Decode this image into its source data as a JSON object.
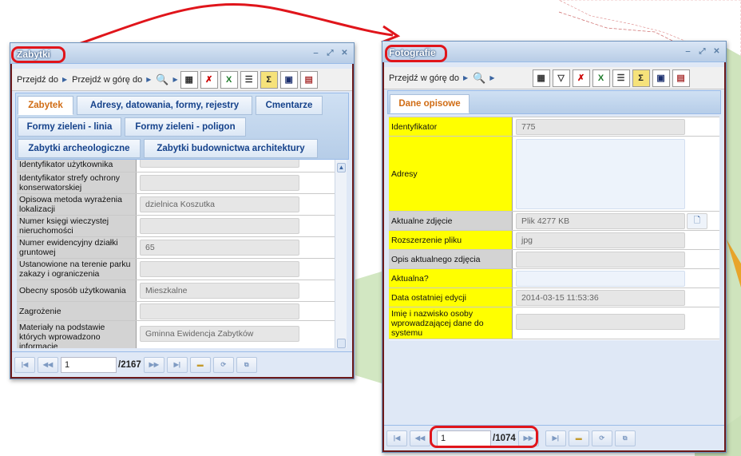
{
  "colors": {
    "highlight": "#e0151b",
    "window_border": "#6d1a1a",
    "required_label": "#ffff00",
    "tab_active_text": "#d06c14"
  },
  "window1": {
    "title": "Zabytki",
    "toolbar": {
      "goto": "Przejdź do",
      "goto_up": "Przejdź w górę do"
    },
    "tabs": [
      "Zabytek",
      "Adresy, datowania, formy, rejestry",
      "Cmentarze",
      "Formy zieleni - linia",
      "Formy zieleni - poligon",
      "Zabytki archeologiczne",
      "Zabytki budownictwa architektury"
    ],
    "rows": [
      {
        "label": "Identyfikator użytkownika",
        "value": ""
      },
      {
        "label": "Identyfikator strefy ochrony konserwatorskiej",
        "value": ""
      },
      {
        "label": "Opisowa metoda wyrażenia lokalizacji",
        "value": "dzielnica Koszutka"
      },
      {
        "label": "Numer księgi wieczystej nieruchomości",
        "value": ""
      },
      {
        "label": "Numer ewidencyjny działki gruntowej",
        "value": "65"
      },
      {
        "label": "Ustanowione na terenie parku zakazy i ograniczenia",
        "value": ""
      },
      {
        "label": "Obecny sposób użytkowania",
        "value": "Mieszkalne"
      },
      {
        "label": "Zagrożenie",
        "value": ""
      },
      {
        "label": "Materiały na podstawie których wprowadzono informacje",
        "value": "Gminna Ewidencja Zabytków"
      }
    ],
    "pager": {
      "page": "1",
      "total": "/2167"
    }
  },
  "window2": {
    "title": "Fotografie",
    "toolbar": {
      "goto_up": "Przejdź w górę do"
    },
    "tabs": [
      "Dane opisowe"
    ],
    "rows": [
      {
        "label": "Identyfikator",
        "value": "775"
      },
      {
        "label": "Adresy",
        "value": ""
      },
      {
        "label": "Aktualne zdjęcie",
        "value": "Plik 4277 KB"
      },
      {
        "label": "Rozszerzenie pliku",
        "value": "jpg"
      },
      {
        "label": "Opis aktualnego zdjęcia",
        "value": ""
      },
      {
        "label": "Aktualna?",
        "value": ""
      },
      {
        "label": "Data ostatniej edycji",
        "value": "2014-03-15 11:53:36"
      },
      {
        "label": "Imię i nazwisko osoby wprowadzającej dane do systemu",
        "value": ""
      }
    ],
    "pager": {
      "page": "1",
      "total": "/1074"
    }
  },
  "icons": [
    "first-page-icon",
    "prev-page-icon",
    "next-page-icon",
    "last-page-icon",
    "open-folder-icon",
    "refresh-icon",
    "copy-icon",
    "search-icon",
    "print-icon",
    "excel-icon",
    "table-icon",
    "sum-icon",
    "save-icon",
    "filter-icon",
    "minimize-icon",
    "maximize-icon",
    "close-icon",
    "file-icon"
  ]
}
